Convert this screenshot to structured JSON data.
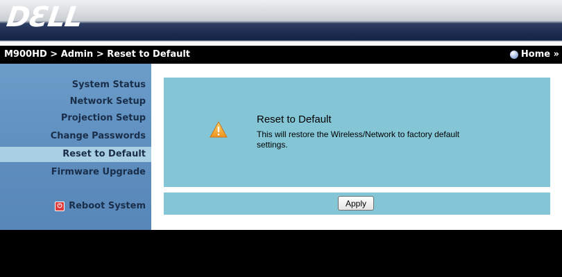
{
  "header": {
    "logo_text": "DƐLL"
  },
  "breadcrumb": {
    "text": "M900HD > Admin > Reset to Default",
    "home_label": "Home »"
  },
  "sidebar": {
    "items": [
      {
        "label": "System Status"
      },
      {
        "label": "Network Setup"
      },
      {
        "label": "Projection Setup"
      },
      {
        "label": "Change Passwords"
      },
      {
        "label": "Reset to Default"
      },
      {
        "label": "Firmware Upgrade"
      }
    ],
    "selected": "Reset to Default",
    "reboot_label": "Reboot System"
  },
  "panel": {
    "title": "Reset to Default",
    "description": "This will restore the Wireless/Network to factory default settings."
  },
  "actions": {
    "apply_label": "Apply"
  },
  "colors": {
    "sidebar": "#5f8fbf",
    "selected_item": "#a9cfe3",
    "panel": "#84c6d6",
    "warning": "#f5a623"
  },
  "icons": [
    "home-icon",
    "reboot-icon",
    "warning-icon"
  ]
}
